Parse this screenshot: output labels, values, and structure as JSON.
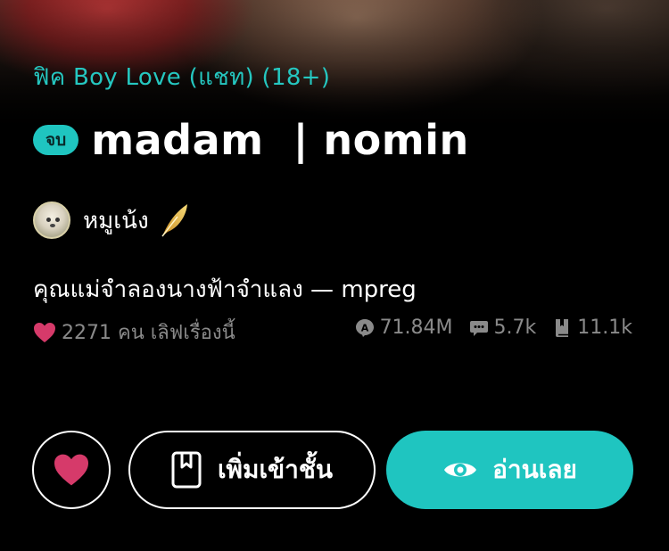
{
  "story": {
    "category": "ฟิค Boy Love (แชท) (18+)",
    "status_badge": "จบ",
    "title": "madam  | nomin",
    "author": "หมูเน้ง",
    "tagline": "คุณแม่จำลองนางฟ้าจำแลง — mpreg"
  },
  "stats": {
    "likes_text": "2271 คน เลิฟเรื่องนี้",
    "views": "71.84M",
    "comments": "5.7k",
    "chapters": "11.1k"
  },
  "actions": {
    "add_to_library": "เพิ่มเข้าชั้น",
    "read_now": "อ่านเลย"
  },
  "colors": {
    "accent": "#1fc5c0",
    "like": "#d63a6a",
    "muted": "#8a8a8a"
  },
  "icons": {
    "author_badge": "quill-icon",
    "likes": "heart-icon",
    "views": "reader-icon",
    "comments": "chat-bubble-icon",
    "chapters": "book-icon",
    "add_to_library": "bookmark-icon",
    "read_now": "eye-icon"
  }
}
